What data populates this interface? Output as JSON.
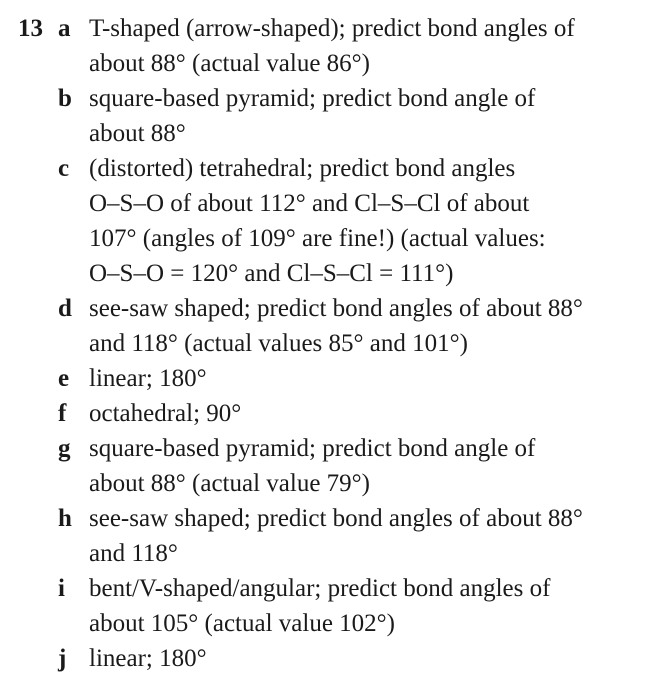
{
  "question": {
    "number": "13",
    "answers": [
      {
        "letter": "a",
        "lines": [
          "T-shaped (arrow-shaped); predict bond angles of",
          "about 88° (actual value 86°)"
        ]
      },
      {
        "letter": "b",
        "lines": [
          "square-based pyramid; predict bond angle of",
          "about 88°"
        ]
      },
      {
        "letter": "c",
        "lines": [
          "(distorted) tetrahedral; predict bond angles",
          "O–S–O of about 112° and Cl–S–Cl of about",
          "107° (angles of 109° are fine!) (actual values:",
          "O–S–O = 120° and Cl–S–Cl = 111°)"
        ]
      },
      {
        "letter": "d",
        "lines": [
          "see-saw shaped; predict bond angles of about 88°",
          "and 118° (actual values 85° and 101°)"
        ]
      },
      {
        "letter": "e",
        "lines": [
          "linear; 180°"
        ]
      },
      {
        "letter": "f",
        "lines": [
          "octahedral; 90°"
        ]
      },
      {
        "letter": "g",
        "lines": [
          "square-based pyramid; predict bond angle of",
          "about 88° (actual value 79°)"
        ]
      },
      {
        "letter": "h",
        "lines": [
          "see-saw shaped; predict bond angles of about 88°",
          "and 118°"
        ]
      },
      {
        "letter": "i",
        "lines": [
          "bent/V-shaped/angular; predict bond angles of",
          "about 105° (actual value 102°)"
        ]
      },
      {
        "letter": "j",
        "lines": [
          "linear; 180°"
        ]
      }
    ]
  }
}
